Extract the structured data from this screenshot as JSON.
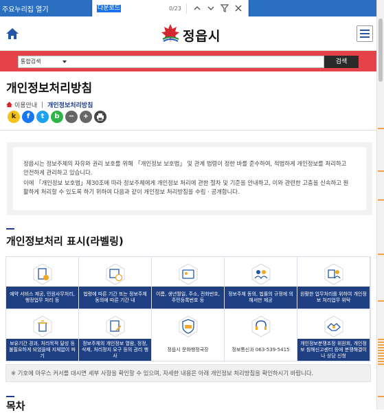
{
  "browser": {
    "skip_link": "주요누리집 열기",
    "find": {
      "query": "다운로드",
      "count": "0/23"
    }
  },
  "header": {
    "logo_text": "정읍시"
  },
  "search": {
    "category": "통합검색",
    "button": "검색"
  },
  "page": {
    "title": "개인정보처리방침",
    "breadcrumb": {
      "parent": "이용안내",
      "current": "개인정보처리방침"
    }
  },
  "share": [
    "k",
    "f",
    "t",
    "b",
    "−",
    "+",
    "print"
  ],
  "intro": {
    "para1": "정읍시는 정보주체의 자유와 권리 보호를 위해 「개인정보 보호법」 및 관계 법령이 정한 바를 준수하여, 적법하게 개인정보를 처리하고 안전하게 관리하고 있습니다.",
    "para2": "이에 「개인정보 보호법」제30조에 따라 정보주체에게 개인정보 처리에 관한 절차 및 기준을 안내하고, 이와 관련한 고충을 신속하고 원활하게 처리할 수 있도록 하기 위하여 다음과 같이 개인정보 처리방침을 수립 · 공개합니다."
  },
  "labeling": {
    "heading": "개인정보처리 표시(라벨링)",
    "tiles": [
      {
        "caption": "예약 서비스 제공, 민원사무처리, 행정업무 처리 등",
        "icon": "document-check-icon"
      },
      {
        "caption": "법령에 따른 기간 또는 정보주체 동의에 따른 기간 내",
        "icon": "calendar-clock-icon"
      },
      {
        "caption": "이름, 생년월일, 주소, 전화번호, 주민등록번호 등",
        "icon": "id-card-icon"
      },
      {
        "caption": "정보주체 동의, 법률의 규정에 의해서만 제공",
        "icon": "share-people-icon"
      },
      {
        "caption": "원활한 업무처리를 위하여 개인정보 처리업무 위탁",
        "icon": "delegate-icon"
      },
      {
        "caption": "보유기간 경과, 처리목적 달성 등 불필요하게 되었을때 지체없이 파기",
        "icon": "trash-icon"
      },
      {
        "caption": "정보주체의 개인정보 열람, 정정, 삭제, 처리정지 요구 등의 권리 행사",
        "icon": "edit-document-icon"
      },
      {
        "caption": "정읍시 문화행정국장",
        "icon": "cpo-badge-icon"
      },
      {
        "caption": "정보통신과 063-539-5415",
        "icon": "headset-icon"
      },
      {
        "caption": "개인정보분쟁조정 위원회, 개인정보 침해신고센터 등에 분쟁해결이나 상담 신청",
        "icon": "handshake-icon"
      }
    ],
    "note": "※ 기호에 마우스 커서를 대시면 세부 사항을 확인할 수 있으며, 자세한 내용은 아래 개인정보 처리방침을 확인하시기 바랍니다."
  },
  "toc": {
    "heading": "목차"
  },
  "colors": {
    "top_bar": "#2b6fc0",
    "search_band": "#e6424a",
    "label_navy": "#1e3f82",
    "accent": "#1b3b8c"
  }
}
